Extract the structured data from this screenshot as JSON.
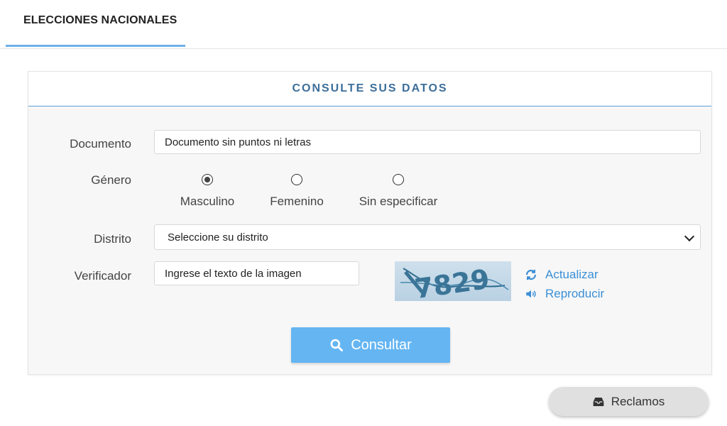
{
  "tabs": [
    {
      "label": "ELECCIONES NACIONALES",
      "active": true
    }
  ],
  "form": {
    "title": "CONSULTE SUS DATOS",
    "documento": {
      "label": "Documento",
      "placeholder": "Documento sin puntos ni letras"
    },
    "genero": {
      "label": "Género",
      "options": [
        {
          "label": "Masculino",
          "checked": true
        },
        {
          "label": "Femenino",
          "checked": false
        },
        {
          "label": "Sin especificar",
          "checked": false
        }
      ]
    },
    "distrito": {
      "label": "Distrito",
      "selected": "Seleccione su distrito"
    },
    "verificador": {
      "label": "Verificador",
      "placeholder": "Ingrese el texto de la imagen",
      "captcha_text": "7829",
      "refresh_label": "Actualizar",
      "audio_label": "Reproducir"
    },
    "submit_label": "Consultar"
  },
  "reclamos_label": "Reclamos",
  "colors": {
    "accent": "#64b5f2",
    "link": "#3b8fd6",
    "title": "#3c6e9a",
    "tab_underline": "#6fb0e6"
  },
  "icons": {
    "submit": "search-icon",
    "refresh": "refresh-icon",
    "audio": "speaker-icon",
    "reclamos": "inbox-icon",
    "select": "chevron-down-icon"
  }
}
